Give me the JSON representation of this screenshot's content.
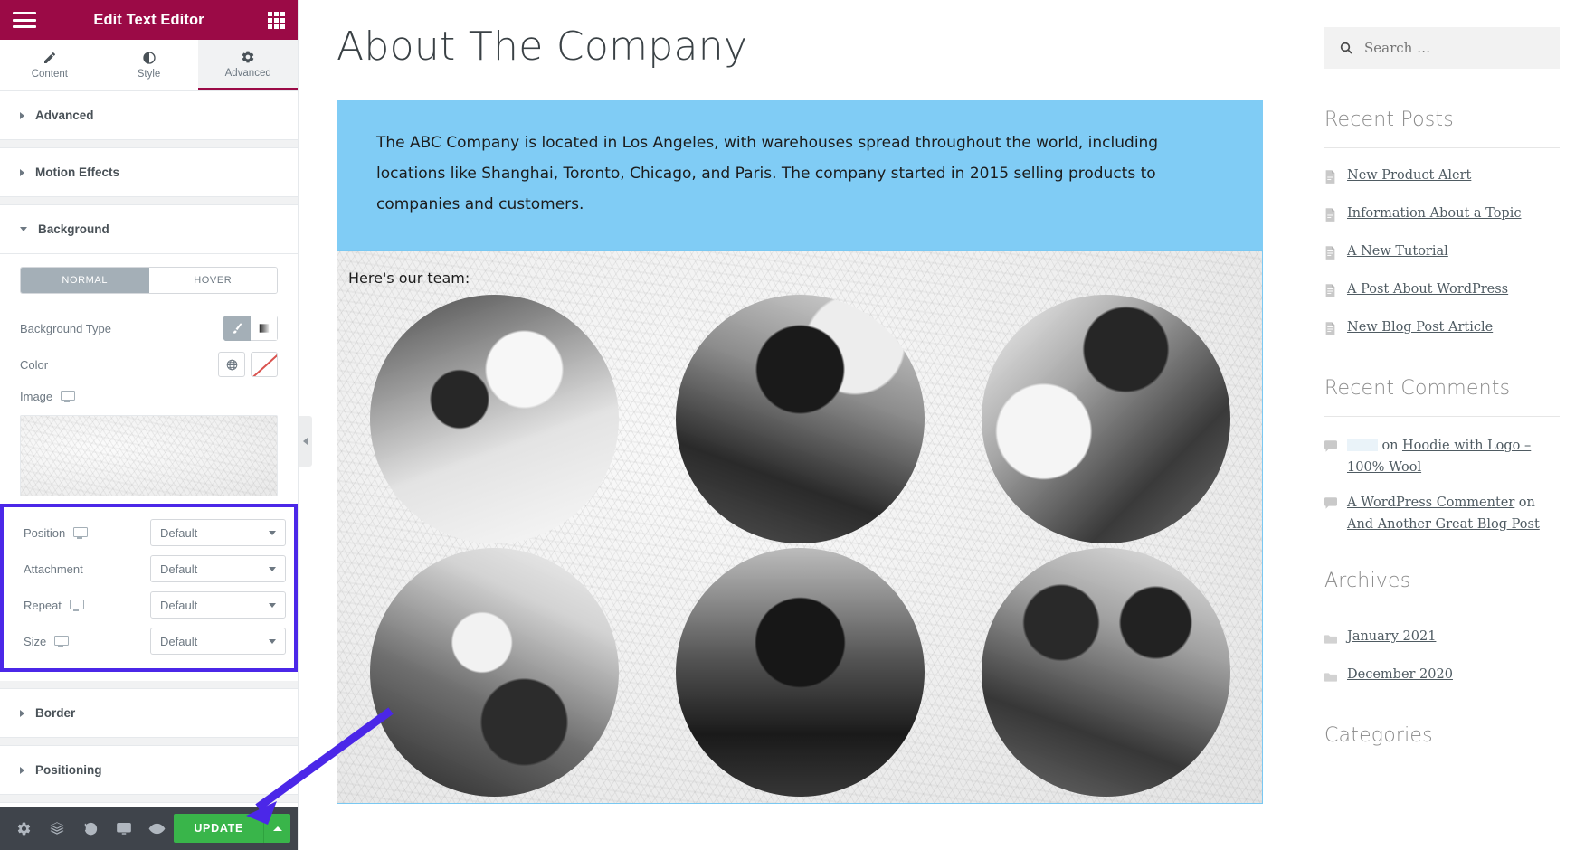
{
  "panel": {
    "title": "Edit Text Editor",
    "menu_icon": "hamburger-icon",
    "apps_icon": "apps-grid-icon",
    "tabs": [
      {
        "label": "Content",
        "icon": "pencil-icon",
        "active": false
      },
      {
        "label": "Style",
        "icon": "contrast-icon",
        "active": false
      },
      {
        "label": "Advanced",
        "icon": "gear-icon",
        "active": true
      }
    ],
    "sections": [
      {
        "label": "Advanced",
        "expanded": false
      },
      {
        "label": "Motion Effects",
        "expanded": false
      },
      {
        "label": "Background",
        "expanded": true
      },
      {
        "label": "Border",
        "expanded": false
      },
      {
        "label": "Positioning",
        "expanded": false
      }
    ],
    "background": {
      "states": [
        {
          "label": "NORMAL",
          "active": true
        },
        {
          "label": "HOVER",
          "active": false
        }
      ],
      "background_type_label": "Background Type",
      "background_type_options": [
        "classic-brush-icon",
        "gradient-icon"
      ],
      "background_type_selected": "classic-brush-icon",
      "color_label": "Color",
      "color_options": [
        "globe-icon",
        "no-color-icon"
      ],
      "image_label": "Image",
      "image_alt": "white textured plaster background preview",
      "fields": [
        {
          "label": "Position",
          "value": "Default",
          "responsive": true
        },
        {
          "label": "Attachment",
          "value": "Default",
          "responsive": false
        },
        {
          "label": "Repeat",
          "value": "Default",
          "responsive": true
        },
        {
          "label": "Size",
          "value": "Default",
          "responsive": true
        }
      ],
      "highlight_color": "#4b27e8"
    },
    "footer": {
      "icons": [
        "settings-gear-icon",
        "navigator-layers-icon",
        "history-revisions-icon",
        "responsive-mode-icon",
        "preview-eye-icon"
      ],
      "update_label": "UPDATE",
      "update_color": "#39b54a",
      "update_caret_icon": "caret-up-icon"
    },
    "collapse_icon": "chevron-left-icon",
    "header_color": "#9b0a46"
  },
  "annotation": {
    "arrow_color": "#4b27e8",
    "points_to": "update-button"
  },
  "preview": {
    "page_title": "About The Company",
    "text_block": {
      "background_color": "#80ccf5",
      "paragraph": "The ABC Company is located in Los Angeles, with warehouses spread throughout the world, including locations like Shanghai, Toronto, Chicago, and Paris. The company started in 2015 selling products to companies and customers."
    },
    "team_block": {
      "label": "Here's our team:",
      "photos": [
        "team-member-1",
        "team-member-2",
        "team-member-3",
        "team-member-4",
        "team-member-5",
        "team-member-6"
      ]
    }
  },
  "sidebar": {
    "search": {
      "icon": "search-icon",
      "placeholder": "Search …",
      "value": ""
    },
    "widgets": [
      {
        "title": "Recent Posts",
        "item_icon": "document-icon",
        "items": [
          {
            "text": "New Product Alert"
          },
          {
            "text": "Information About a Topic"
          },
          {
            "text": "A New Tutorial"
          },
          {
            "text": "A Post About WordPress"
          },
          {
            "text": "New Blog Post Article"
          }
        ]
      },
      {
        "title": "Recent Comments",
        "item_icon": "comment-bubble-icon",
        "comments": [
          {
            "author": "",
            "author_redacted": true,
            "on": "on",
            "post": "Hoodie with Logo – 100% Wool"
          },
          {
            "author": "A WordPress Commenter",
            "author_redacted": false,
            "on": "on",
            "post": "And Another Great Blog Post"
          }
        ]
      },
      {
        "title": "Archives",
        "item_icon": "folder-icon",
        "items": [
          {
            "text": "January 2021"
          },
          {
            "text": "December 2020"
          }
        ]
      },
      {
        "title": "Categories",
        "item_icon": "folder-icon",
        "items": []
      }
    ]
  }
}
